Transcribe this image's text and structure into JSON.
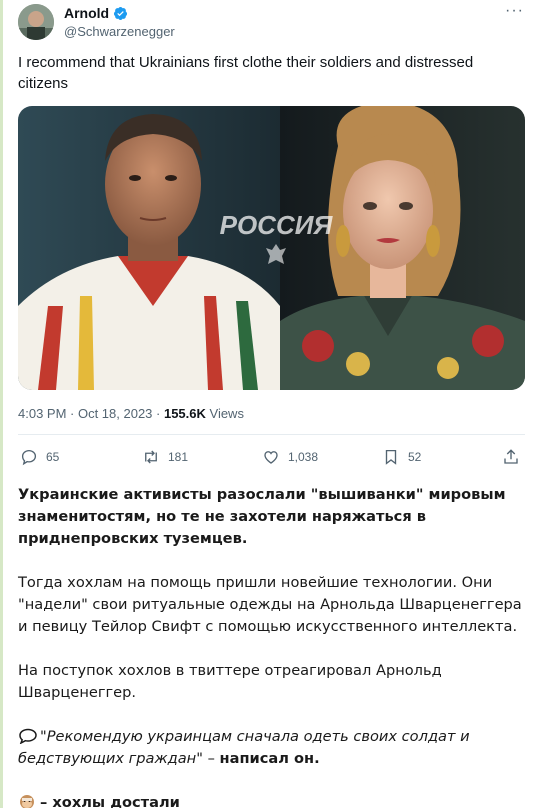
{
  "tweet": {
    "author_name": "Arnold",
    "handle": "@Schwarzenegger",
    "more_label": "···",
    "text": "I recommend that Ukrainians first clothe their soldiers and distressed citizens",
    "image_overlay_text": "РОССИЯ",
    "time": "4:03 PM · Oct 18, 2023 · ",
    "views_count": "155.6K",
    "views_label": " Views"
  },
  "actions": {
    "replies": "65",
    "retweets": "181",
    "likes": "1,038",
    "bookmarks": "52"
  },
  "article": {
    "paragraph1": "Украинские активисты разослали \"вышиванки\" мировым знаменитостям, но те не захотели наряжаться в приднепровских туземцев.",
    "paragraph2": "Тогда хохлам на помощь пришли новейшие технологии. Они \"надели\" свои ритуальные одежды на Арнольда Шварценеггера и певицу Тейлор Свифт с помощью искусственного интеллекта.",
    "paragraph3": "На поступок хохлов в твиттере отреагировал Арнольд Шварценеггер.",
    "quote_italic": "\"Рекомендую украинцам сначала одеть своих солдат и бедствующих граждан\"",
    "quote_dash": " – ",
    "quote_tail": "написал он.",
    "final_line": "– хохлы достали"
  },
  "colors": {
    "verified": "#1d9bf0",
    "muted": "#536471",
    "left_bar": "#d6e8c6"
  }
}
